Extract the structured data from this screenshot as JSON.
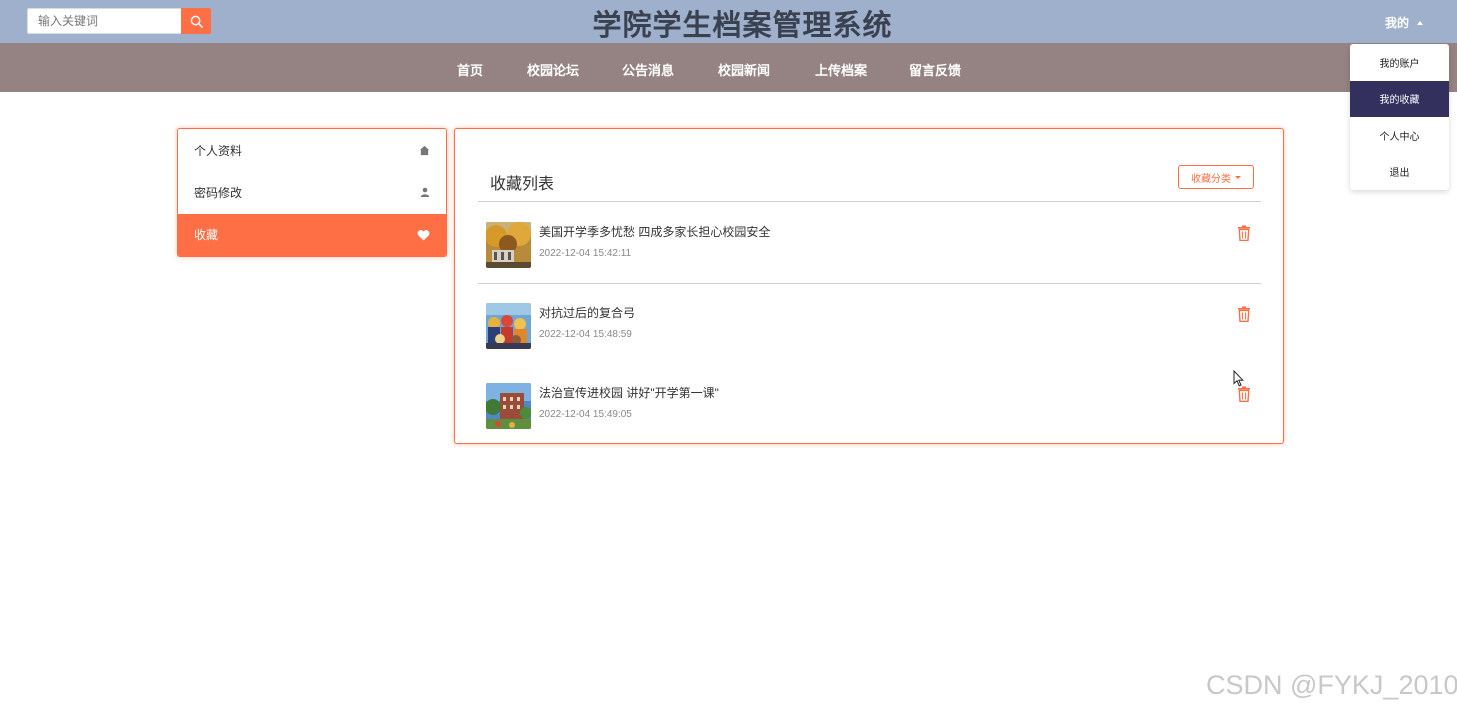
{
  "header": {
    "title": "学院学生档案管理系统",
    "search": {
      "placeholder": "输入关键词"
    },
    "user_menu_label": "我的"
  },
  "nav": {
    "items": [
      {
        "label": "首页"
      },
      {
        "label": "校园论坛"
      },
      {
        "label": "公告消息"
      },
      {
        "label": "校园新闻"
      },
      {
        "label": "上传档案"
      },
      {
        "label": "留言反馈"
      }
    ]
  },
  "user_dropdown": {
    "items": [
      {
        "label": "我的账户",
        "active": false
      },
      {
        "label": "我的收藏",
        "active": true
      },
      {
        "label": "个人中心",
        "active": false
      },
      {
        "label": "退出",
        "active": false
      }
    ]
  },
  "sidebar": {
    "items": [
      {
        "label": "个人资料",
        "icon": "home-icon",
        "active": false
      },
      {
        "label": "密码修改",
        "icon": "user-icon",
        "active": false
      },
      {
        "label": "收藏",
        "icon": "heart-icon",
        "active": true
      }
    ]
  },
  "favorites": {
    "title": "收藏列表",
    "category_button": "收藏分类",
    "items": [
      {
        "title": "美国开学季多忧愁 四成多家长担心校园安全",
        "date": "2022-12-04 15:42:11",
        "thumb": "autumn-campus-image"
      },
      {
        "title": "对抗过后的复合弓",
        "date": "2022-12-04 15:48:59",
        "thumb": "crowd-image"
      },
      {
        "title": "法治宣传进校园 讲好\"开学第一课\"",
        "date": "2022-12-04 15:49:05",
        "thumb": "campus-building-image"
      }
    ]
  },
  "colors": {
    "accent": "#fe6f45",
    "header_bg": "#9fb0cc",
    "nav_bg": "#948382",
    "dropdown_active": "#33305e"
  },
  "watermark": "CSDN @FYKJ_2010"
}
